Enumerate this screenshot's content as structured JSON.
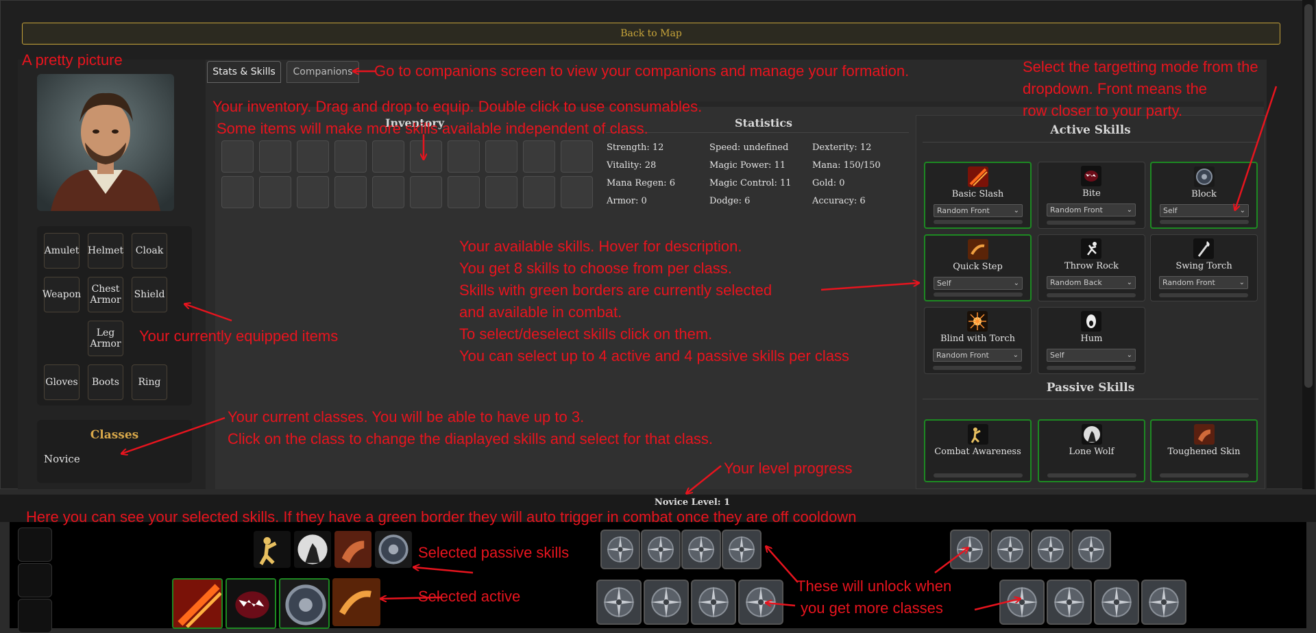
{
  "topbar": {
    "back_label": "Back to Map"
  },
  "tabs": [
    {
      "label": "Stats & Skills",
      "active": true
    },
    {
      "label": "Companions",
      "active": false
    }
  ],
  "equipment": {
    "slots": [
      "Amulet",
      "Helmet",
      "Cloak",
      "Weapon",
      "Chest Armor",
      "Shield",
      "Leg Armor",
      "Gloves",
      "Boots",
      "Ring"
    ]
  },
  "classes": {
    "title": "Classes",
    "items": [
      "Novice"
    ]
  },
  "inventory": {
    "title": "Inventory",
    "slot_count": 20
  },
  "statistics": {
    "title": "Statistics",
    "items": [
      "Strength: 12",
      "Speed: undefined",
      "Dexterity: 12",
      "Vitality: 28",
      "Magic Power: 11",
      "Mana: 150/150",
      "Mana Regen: 6",
      "Magic Control: 11",
      "Gold: 0",
      "Armor: 0",
      "Dodge: 6",
      "Accuracy: 6"
    ]
  },
  "skills": {
    "active_title": "Active Skills",
    "passive_title": "Passive Skills",
    "active": [
      {
        "name": "Basic Slash",
        "target": "Random Front",
        "selected": true,
        "icon": "slash-icon"
      },
      {
        "name": "Bite",
        "target": "Random Front",
        "selected": false,
        "icon": "bite-icon"
      },
      {
        "name": "Block",
        "target": "Self",
        "selected": true,
        "icon": "shield-icon"
      },
      {
        "name": "Quick Step",
        "target": "Self",
        "selected": true,
        "icon": "step-icon"
      },
      {
        "name": "Throw Rock",
        "target": "Random Back",
        "selected": false,
        "icon": "throw-icon"
      },
      {
        "name": "Swing Torch",
        "target": "Random Front",
        "selected": false,
        "icon": "torch-icon"
      },
      {
        "name": "Blind with Torch",
        "target": "Random Front",
        "selected": false,
        "icon": "flash-icon"
      },
      {
        "name": "Hum",
        "target": "Self",
        "selected": false,
        "icon": "hum-icon"
      }
    ],
    "passive": [
      {
        "name": "Combat Awareness",
        "selected": true,
        "icon": "combat-awareness-icon"
      },
      {
        "name": "Lone Wolf",
        "selected": true,
        "icon": "wolf-icon"
      },
      {
        "name": "Toughened Skin",
        "selected": true,
        "icon": "skin-icon"
      }
    ]
  },
  "level": {
    "label": "Novice Level: 1"
  },
  "annotations": {
    "portrait": "A pretty picture",
    "companions": "Go to companions screen to view your companions and manage your formation.",
    "targeting": [
      "Select the targetting mode from the",
      "dropdown.  Front means the",
      "row closer to your party."
    ],
    "inventory": [
      "Your inventory. Drag and drop to equip. Double click to use consumables.",
      "Some items will make more skills available independent of class."
    ],
    "skills": [
      "Your available skills. Hover for description.",
      "You get 8 skills to choose from per class.",
      "Skills with green borders are currently selected",
      "and available in combat.",
      "To select/deselect skills click on them.",
      "You can select up to 4 active and 4 passive skills per class"
    ],
    "equipped": "Your currently equipped items",
    "classes": [
      "Your current classes. You will be able to have up to 3.",
      "Click on the class to change the diaplayed skills and select for that class."
    ],
    "level": "Your level progress",
    "selected": "Here you can see your selected skills. If they have a green border they will auto trigger in combat once they are off cooldown",
    "passive": "Selected passive skills",
    "active": "Selected active",
    "unlock": [
      "These will unlock when",
      "you get more classes"
    ]
  },
  "colors": {
    "annotation": "#e8141e",
    "selected_border": "#1d8a22",
    "gold": "#c8a53a"
  }
}
